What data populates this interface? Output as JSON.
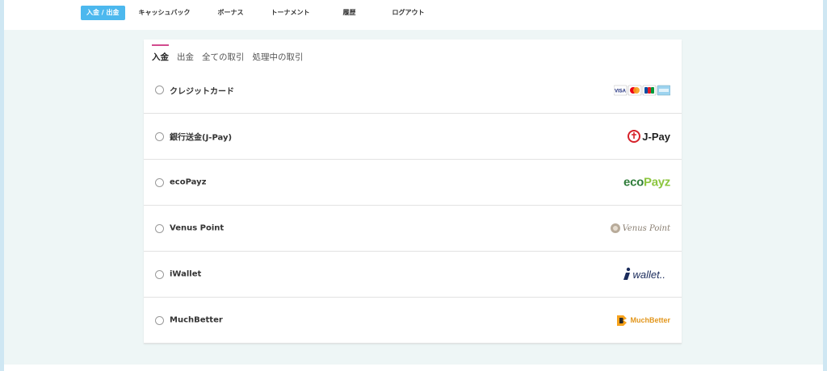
{
  "nav": {
    "items": [
      {
        "label": "入金 / 出金",
        "active": true
      },
      {
        "label": "キャッシュバック"
      },
      {
        "label": "ボーナス"
      },
      {
        "label": "トーナメント"
      },
      {
        "label": "履歴"
      },
      {
        "label": "ログアウト"
      }
    ]
  },
  "tabs": [
    "入金",
    "出金",
    "全ての取引",
    "処理中の取引"
  ],
  "methods": [
    {
      "label": "クレジットカード",
      "logo": "visa-mastercard-jcb-amex-logos"
    },
    {
      "label": "銀行送金(J-Pay)",
      "logo": "jpay-logo",
      "logo_text": "J-Pay"
    },
    {
      "label": "ecoPayz",
      "logo": "ecopayz-logo"
    },
    {
      "label": "Venus Point",
      "logo": "venus-point-logo",
      "logo_text": "Venus Point"
    },
    {
      "label": "iWallet",
      "logo": "iwallet-logo",
      "logo_text": "wallet.."
    },
    {
      "label": "MuchBetter",
      "logo": "muchbetter-logo",
      "logo_text": "MuchBetter"
    }
  ],
  "colors": {
    "accent": "#4cb8ee",
    "tab_underline": "#d24b8e",
    "background": "#eef6f6"
  }
}
